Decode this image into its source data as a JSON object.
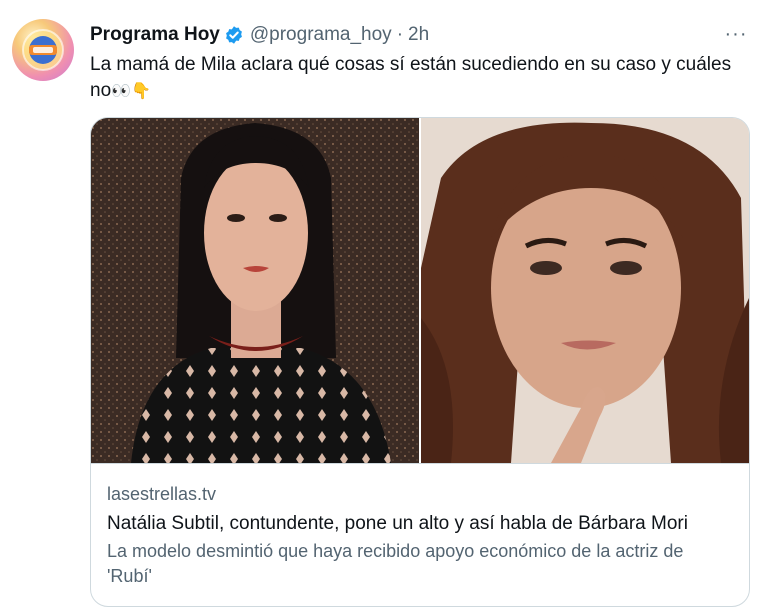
{
  "tweet": {
    "display_name": "Programa Hoy",
    "handle": "@programa_hoy",
    "separator": "·",
    "time": "2h",
    "more_label": "···",
    "text": "La mamá de Mila aclara qué cosas sí están sucediendo en su caso y cuáles no",
    "emojis": "👀👇",
    "verified_icon": "verified-badge-icon",
    "verified_color": "#1d9bf0"
  },
  "card": {
    "domain": "lasestrellas.tv",
    "title": "Natália Subtil, contundente, pone un alto y así habla de Bárbara Mori",
    "description": "La modelo desmintió que haya recibido apoyo económico de la actriz de 'Rubí'"
  },
  "colors": {
    "text": "#0f1419",
    "muted": "#536471",
    "border": "#cfd9de",
    "verified": "#1d9bf0"
  }
}
